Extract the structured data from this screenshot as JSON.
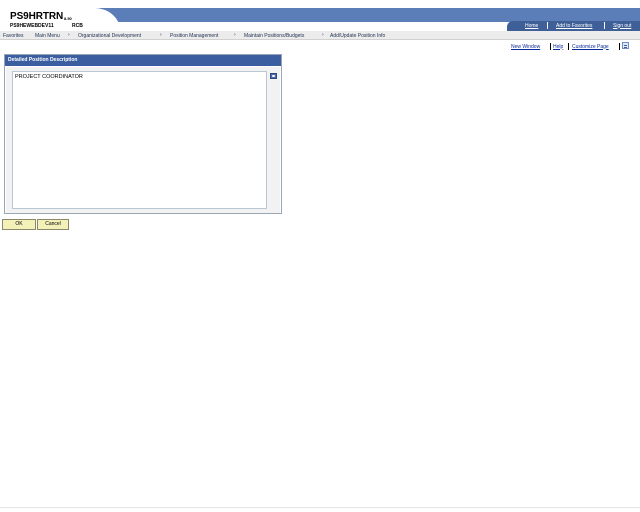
{
  "header": {
    "app_name": "PS9HRTRN",
    "app_version": "8.50",
    "db_name": "PS9HEWEBDEV11",
    "db_code": "RCB",
    "links": [
      "Home",
      "Add to Favorites",
      "Sign out"
    ],
    "colors": {
      "banner": "#5b7db8",
      "banner_dark": "#3f5f99"
    }
  },
  "breadcrumb": {
    "items": [
      "Favorites",
      "Main Menu",
      "Organizational Development",
      "Position Management",
      "Maintain Positions/Budgets",
      "Add/Update Position Info"
    ],
    "separator_icon": "chevron-right-icon"
  },
  "page_links": {
    "new_window": "New Window",
    "help": "Help",
    "customize": "Customize Page",
    "icon": "page-icon"
  },
  "group": {
    "title": "Detailed Position Description",
    "description_value": "PROJECT COORDINATOR",
    "zoom_icon": "zoom-icon"
  },
  "buttons": {
    "ok": "OK",
    "cancel": "Cancel",
    "color": "#f3f0b8"
  }
}
